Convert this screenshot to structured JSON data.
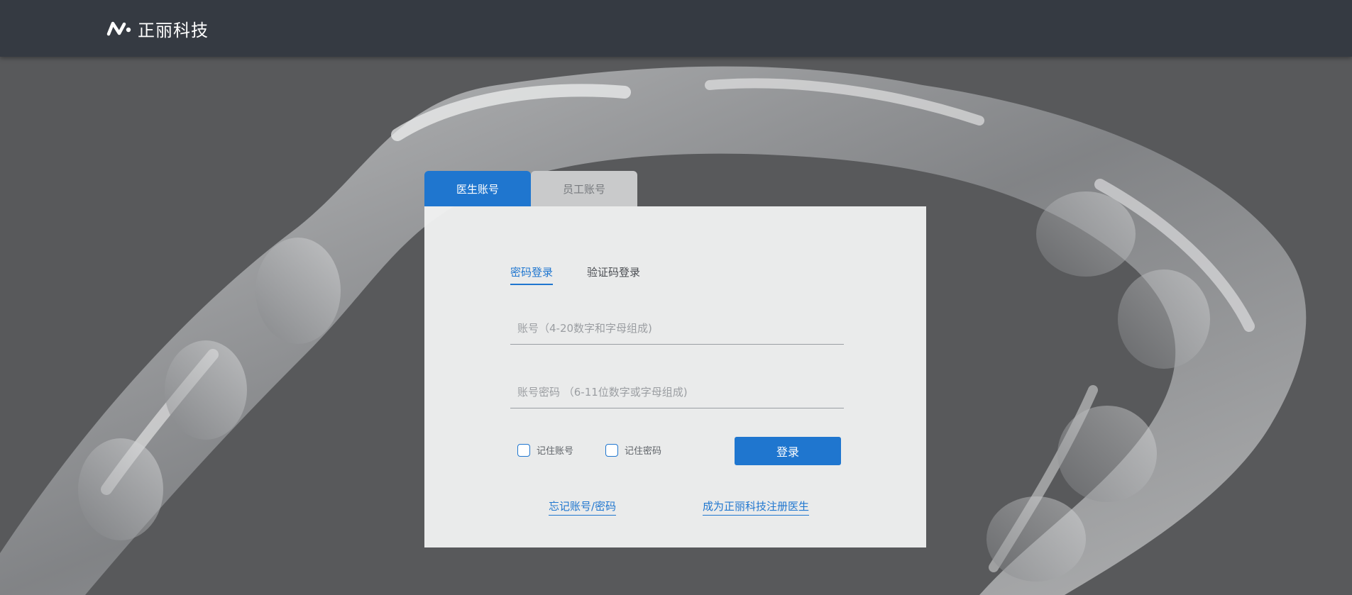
{
  "header": {
    "brand_name": "正丽科技",
    "logo_icon": "zhengli-logo-icon"
  },
  "login": {
    "account_tabs": [
      {
        "label": "医生账号",
        "active": true
      },
      {
        "label": "员工账号",
        "active": false
      }
    ],
    "mode_tabs": [
      {
        "label": "密码登录",
        "active": true
      },
      {
        "label": "验证码登录",
        "active": false
      }
    ],
    "account_placeholder": "账号（4-20数字和字母组成)",
    "account_value": "",
    "password_placeholder": "账号密码 （6-11位数字或字母组成)",
    "password_value": "",
    "remember_account_label": "记住账号",
    "remember_account_checked": false,
    "remember_password_label": "记住密码",
    "remember_password_checked": false,
    "submit_label": "登录",
    "forgot_link": "忘记账号/密码",
    "register_link": "成为正丽科技注册医生"
  },
  "colors": {
    "header_bg": "#353a42",
    "page_bg": "#58595b",
    "accent": "#1f76cf",
    "card_bg": "#f0f1f1"
  }
}
